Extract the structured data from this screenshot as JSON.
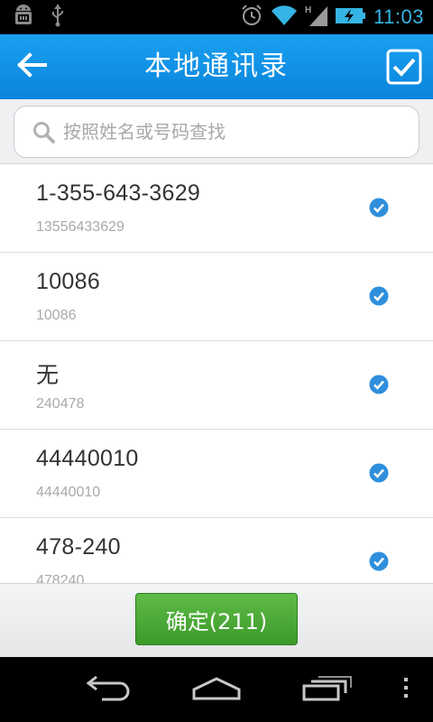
{
  "status_bar": {
    "time": "11:03",
    "icons": [
      "android-debug-icon",
      "usb-icon",
      "alarm-icon",
      "wifi-icon",
      "signal-icon",
      "battery-charging-icon"
    ]
  },
  "header": {
    "title": "本地通讯录",
    "back_icon": "back-arrow-icon",
    "select_all_icon": "checkbox-checked-icon"
  },
  "search": {
    "placeholder": "按照姓名或号码查找",
    "value": ""
  },
  "contacts": [
    {
      "name": "1-355-643-3629",
      "number": "13556433629",
      "checked": true
    },
    {
      "name": "10086",
      "number": "10086",
      "checked": true
    },
    {
      "name": "无",
      "number": "240478",
      "checked": true
    },
    {
      "name": "44440010",
      "number": "44440010",
      "checked": true
    },
    {
      "name": "478-240",
      "number": "478240",
      "checked": true
    }
  ],
  "footer": {
    "confirm_label": "确定(211)"
  },
  "colors": {
    "accent": "#35b5e5",
    "title_bar": "#0a84dc",
    "check": "#2f8fdc",
    "confirm": "#4aa534"
  }
}
